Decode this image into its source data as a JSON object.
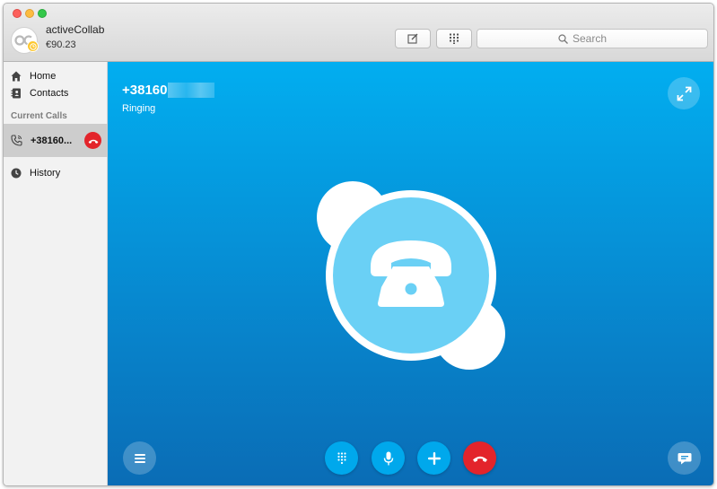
{
  "window": {
    "traffic_lights": [
      "close",
      "minimize",
      "zoom"
    ]
  },
  "account": {
    "name": "activeCollab",
    "credit": "€90.23",
    "avatar_icon": "activecollab-logo-icon",
    "status_icon": "clock-status-icon",
    "status_color": "#fdc72f"
  },
  "toolbar": {
    "compose_icon": "compose-icon",
    "dialpad_icon": "dialpad-icon",
    "search": {
      "placeholder": "Search",
      "value": ""
    }
  },
  "sidebar": {
    "items": [
      {
        "label": "Home",
        "icon": "home-icon"
      },
      {
        "label": "Contacts",
        "icon": "contacts-icon"
      }
    ],
    "section_label": "Current Calls",
    "current_call": {
      "label": "+38160...",
      "icon": "phone-icon",
      "hangup_icon": "hang-up-icon",
      "hangup_color": "#e3242b"
    },
    "history": {
      "label": "History",
      "icon": "clock-icon"
    }
  },
  "call": {
    "number": "+38160",
    "status": "Ringing",
    "background_colors": [
      "#02aef0",
      "#0a6cb5"
    ],
    "expand_icon": "expand-icon",
    "center_icon": "skype-logo-phone-icon"
  },
  "controls": [
    {
      "name": "menu",
      "icon": "menu-icon"
    },
    {
      "name": "dialpad",
      "icon": "dialpad-icon"
    },
    {
      "name": "mute",
      "icon": "microphone-icon"
    },
    {
      "name": "add",
      "icon": "plus-icon"
    },
    {
      "name": "hang-up",
      "icon": "hang-up-icon",
      "color": "#e3242b"
    },
    {
      "name": "chat",
      "icon": "chat-icon"
    }
  ]
}
